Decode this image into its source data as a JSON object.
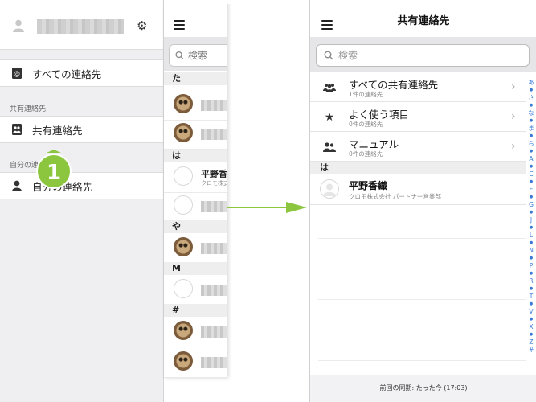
{
  "sidebar": {
    "items": {
      "all": "すべての連絡先",
      "shared": "共有連絡先",
      "mine": "自分の連絡先"
    },
    "sections": {
      "shared": "共有連絡先",
      "mine": "自分の連絡先"
    },
    "step_badge": "1"
  },
  "middle": {
    "search_placeholder": "検索",
    "sections": [
      "た",
      "は",
      "や",
      "M",
      "#"
    ],
    "contact": {
      "name": "平野香織",
      "company": "クロモ株式会社"
    }
  },
  "right": {
    "title": "共有連絡先",
    "search_placeholder": "検索",
    "groups": [
      {
        "label": "すべての共有連絡先",
        "count": "1件の連絡先"
      },
      {
        "label": "よく使う項目",
        "count": "0件の連絡先"
      },
      {
        "label": "マニュアル",
        "count": "0件の連絡先"
      }
    ],
    "section_ha": "は",
    "contact": {
      "name": "平野香織",
      "company": "クロモ株式会社 パートナー営業部"
    },
    "index": [
      "あ",
      "●",
      "さ",
      "●",
      "な",
      "●",
      "ま",
      "●",
      "ら",
      "●",
      "A",
      "●",
      "C",
      "●",
      "E",
      "●",
      "G",
      "●",
      "J",
      "●",
      "L",
      "●",
      "N",
      "●",
      "P",
      "●",
      "R",
      "●",
      "T",
      "●",
      "V",
      "●",
      "X",
      "●",
      "Z",
      "#"
    ],
    "sync_status": "前回の同期: たった今 (17:03)"
  },
  "colors": {
    "accent_green": "#8cc63f",
    "index_blue": "#3a7bd5"
  }
}
